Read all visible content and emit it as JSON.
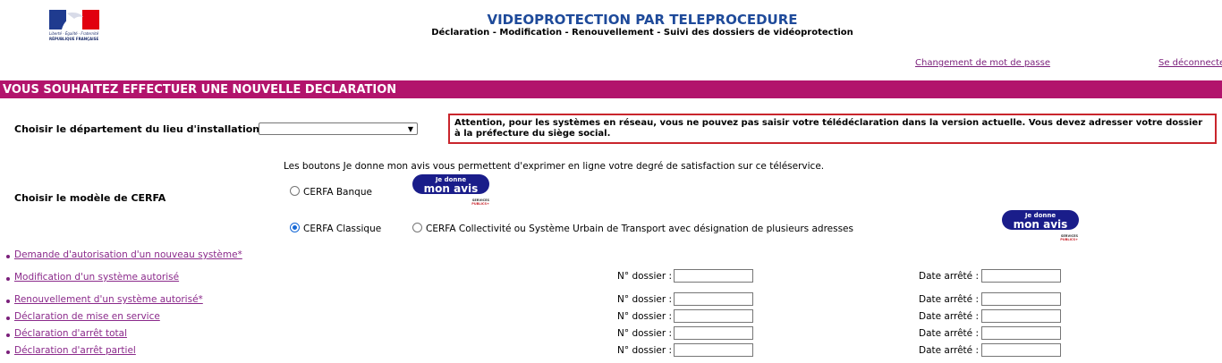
{
  "logo": {
    "motto": "Liberté · Égalité · Fraternité",
    "republic": "RÉPUBLIQUE FRANÇAISE"
  },
  "header": {
    "title": "VIDEOPROTECTION PAR TELEPROCEDURE",
    "subtitle": "Déclaration - Modification - Renouvellement - Suivi des dossiers de vidéoprotection"
  },
  "top_links": {
    "change_password": "Changement de mot de passe",
    "logout": "Se déconnecter"
  },
  "section_title": "VOUS SOUHAITEZ EFFECTUER UNE NOUVELLE DECLARATION",
  "department": {
    "label": "Choisir le département du lieu d'installation",
    "selected": ""
  },
  "alert": "Attention, pour les systèmes en réseau, vous ne pouvez pas saisir votre télédéclaration dans la version actuelle. Vous devez adresser votre dossier à la préfecture du siège social.",
  "info": "Les boutons Je donne mon avis vous permettent d'exprimer en ligne votre degré de satisfaction sur ce téléservice.",
  "cerfa": {
    "label": "Choisir le modèle de CERFA",
    "options": [
      {
        "label": "CERFA Banque",
        "checked": false
      },
      {
        "label": "CERFA Classique",
        "checked": true
      },
      {
        "label": "CERFA Collectivité ou Système Urbain de Transport avec désignation de plusieurs adresses",
        "checked": false
      }
    ]
  },
  "avis_button": {
    "line1": "Je donne",
    "line2": "mon avis",
    "services": "SERVICES",
    "publics": "PUBLICS+"
  },
  "actions": [
    {
      "label": "Demande d'autorisation d'un nouveau système*"
    },
    {
      "label": "Modification d'un système autorisé"
    },
    {
      "label": "Renouvellement d'un système autorisé*"
    },
    {
      "label": "Déclaration de mise en service"
    },
    {
      "label": "Déclaration d'arrêt total"
    },
    {
      "label": "Déclaration d'arrêt partiel"
    }
  ],
  "fields": {
    "dossier_label": "N° dossier :",
    "date_label": "Date arrêté :"
  },
  "colors": {
    "bar": "#b2146c",
    "title": "#1e4a9a",
    "link": "#8b2a8b",
    "alert_border": "#c9252c",
    "avis": "#1a1d8a"
  }
}
